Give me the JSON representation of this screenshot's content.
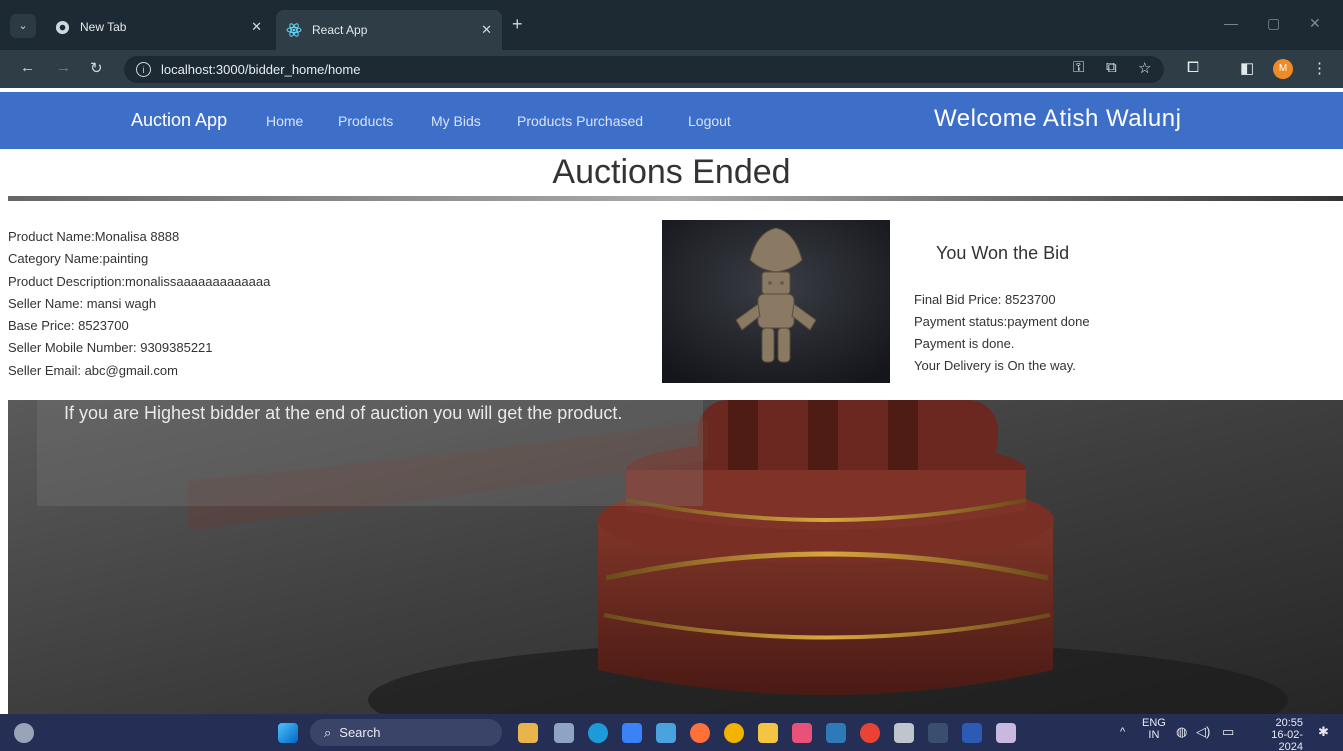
{
  "browser": {
    "tabs": [
      {
        "title": "New Tab",
        "active": false,
        "icon": "chrome-icon"
      },
      {
        "title": "React App",
        "active": true,
        "icon": "react-icon"
      }
    ],
    "url": "localhost:3000/bidder_home/home",
    "profile_initial": "M"
  },
  "navbar": {
    "brand": "Auction App",
    "links": [
      "Home",
      "Products",
      "My Bids",
      "Products Purchased",
      "Logout"
    ],
    "welcome": "Welcome Atish Walunj",
    "color": "#3d6fc9"
  },
  "page": {
    "title": "Auctions Ended"
  },
  "product": {
    "name": "Product Name:Monalisa 8888",
    "category": "Category Name:painting",
    "description": "Product Description:monalissaaaaaaaaaaaaa",
    "seller_name": "Seller Name: mansi wagh",
    "base_price": "Base Price: 8523700",
    "seller_mobile": "Seller Mobile Number: 9309385221",
    "seller_email": "Seller Email: abc@gmail.com"
  },
  "result": {
    "heading": "You Won the Bid",
    "final_price": "Final Bid Price: 8523700",
    "payment_status": "Payment status:payment done",
    "payment_note": "Payment is done.",
    "delivery": "Your Delivery is On the way."
  },
  "hero": {
    "text": "If you are Highest bidder at the end of auction you will get the product."
  },
  "taskbar": {
    "search_placeholder": "Search",
    "lang_top": "ENG",
    "lang_bottom": "IN",
    "time": "20:55",
    "date": "16-02-2024"
  }
}
